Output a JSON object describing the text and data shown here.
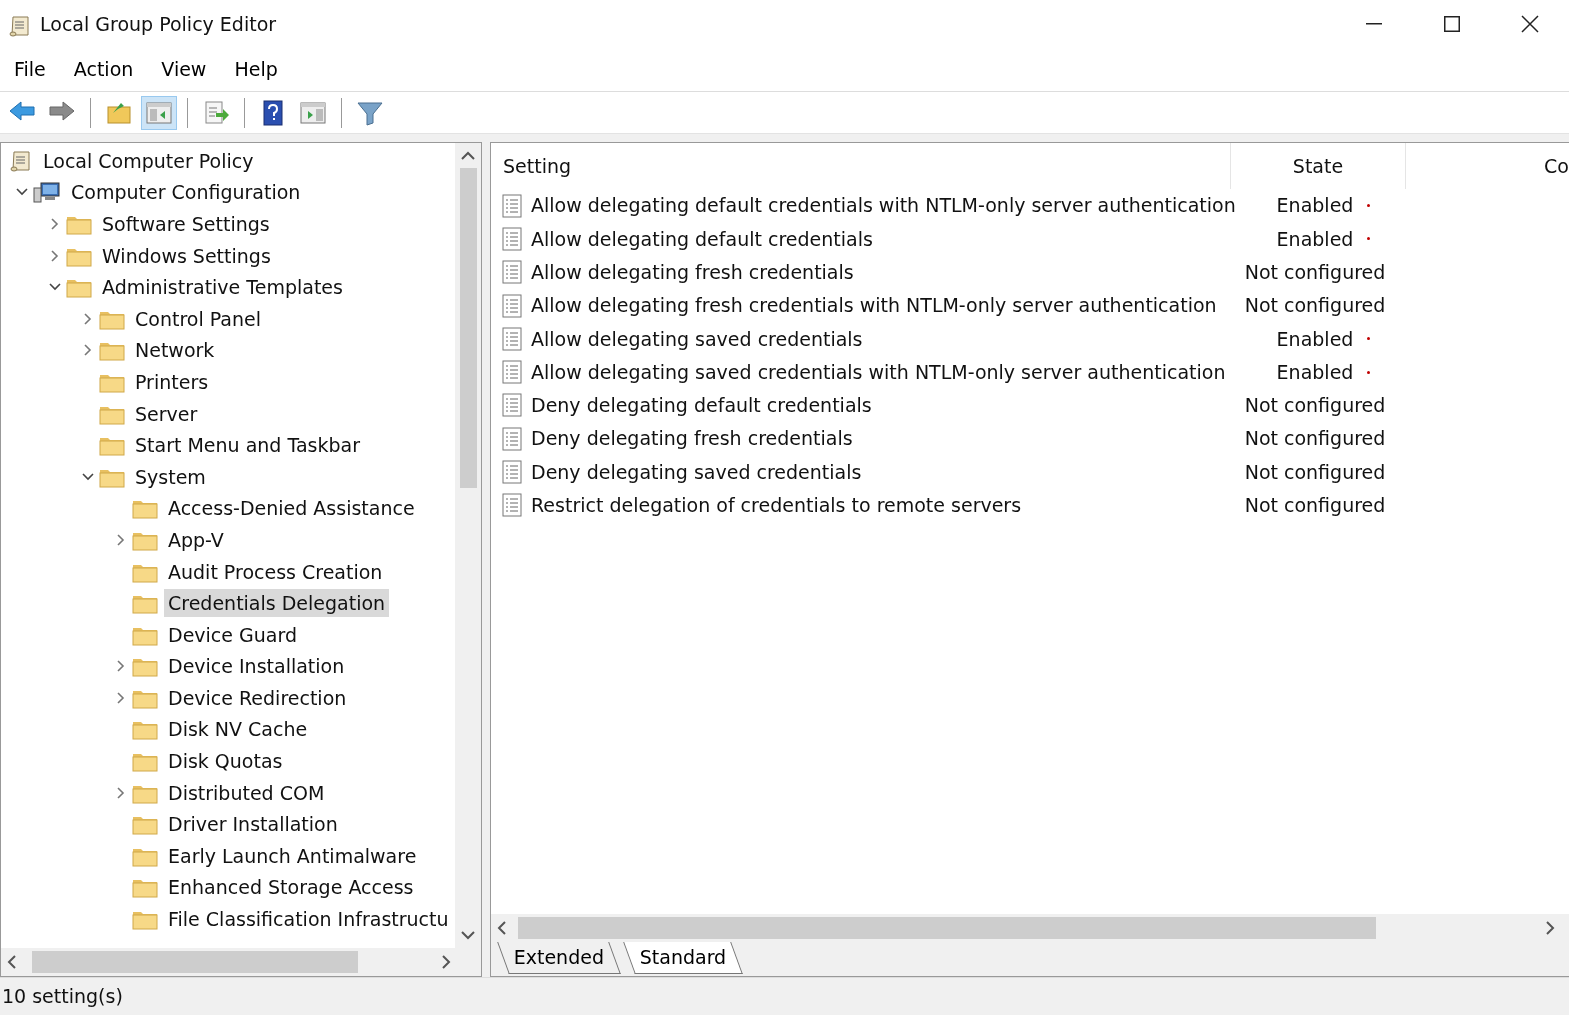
{
  "window": {
    "title": "Local Group Policy Editor"
  },
  "menu": [
    "File",
    "Action",
    "View",
    "Help"
  ],
  "toolbar": [
    {
      "kind": "back"
    },
    {
      "kind": "forward"
    },
    {
      "kind": "sep"
    },
    {
      "kind": "up"
    },
    {
      "kind": "pane",
      "selected": true
    },
    {
      "kind": "sep"
    },
    {
      "kind": "export"
    },
    {
      "kind": "sep"
    },
    {
      "kind": "help"
    },
    {
      "kind": "panel"
    },
    {
      "kind": "sep"
    },
    {
      "kind": "filter"
    }
  ],
  "tree": [
    {
      "label": "Local Computer Policy",
      "kind": "policy",
      "selected": false,
      "children": [
        {
          "label": "Computer Configuration",
          "kind": "computer",
          "expanded": true,
          "selected": false,
          "children": [
            {
              "label": "Software Settings",
              "kind": "folder",
              "expanded": false,
              "selected": false
            },
            {
              "label": "Windows Settings",
              "kind": "folder",
              "expanded": false,
              "selected": false
            },
            {
              "label": "Administrative Templates",
              "kind": "folder",
              "expanded": true,
              "selected": false,
              "children": [
                {
                  "label": "Control Panel",
                  "kind": "folder",
                  "expanded": false,
                  "selected": false
                },
                {
                  "label": "Network",
                  "kind": "folder",
                  "expanded": false,
                  "selected": false
                },
                {
                  "label": "Printers",
                  "kind": "folder",
                  "selected": false
                },
                {
                  "label": "Server",
                  "kind": "folder",
                  "selected": false
                },
                {
                  "label": "Start Menu and Taskbar",
                  "kind": "folder",
                  "selected": false
                },
                {
                  "label": "System",
                  "kind": "folder",
                  "expanded": true,
                  "selected": false,
                  "children": [
                    {
                      "label": "Access-Denied Assistance",
                      "kind": "folder",
                      "selected": false
                    },
                    {
                      "label": "App-V",
                      "kind": "folder",
                      "expanded": false,
                      "selected": false
                    },
                    {
                      "label": "Audit Process Creation",
                      "kind": "folder",
                      "selected": false
                    },
                    {
                      "label": "Credentials Delegation",
                      "kind": "folder",
                      "selected": true
                    },
                    {
                      "label": "Device Guard",
                      "kind": "folder",
                      "selected": false
                    },
                    {
                      "label": "Device Installation",
                      "kind": "folder",
                      "expanded": false,
                      "selected": false
                    },
                    {
                      "label": "Device Redirection",
                      "kind": "folder",
                      "expanded": false,
                      "selected": false
                    },
                    {
                      "label": "Disk NV Cache",
                      "kind": "folder",
                      "selected": false
                    },
                    {
                      "label": "Disk Quotas",
                      "kind": "folder",
                      "selected": false
                    },
                    {
                      "label": "Distributed COM",
                      "kind": "folder",
                      "expanded": false,
                      "selected": false
                    },
                    {
                      "label": "Driver Installation",
                      "kind": "folder",
                      "selected": false
                    },
                    {
                      "label": "Early Launch Antimalware",
                      "kind": "folder",
                      "selected": false
                    },
                    {
                      "label": "Enhanced Storage Access",
                      "kind": "folder",
                      "selected": false
                    },
                    {
                      "label": "File Classification Infrastructu",
                      "kind": "folder",
                      "selected": false
                    }
                  ]
                }
              ]
            }
          ]
        }
      ]
    }
  ],
  "table": {
    "columns": [
      "Setting",
      "State",
      "Co"
    ],
    "rows": [
      {
        "setting": "Allow delegating default credentials with NTLM-only server authentication",
        "state": "Enabled",
        "flagged": true
      },
      {
        "setting": "Allow delegating default credentials",
        "state": "Enabled",
        "flagged": true
      },
      {
        "setting": "Allow delegating fresh credentials",
        "state": "Not configured",
        "flagged": false
      },
      {
        "setting": "Allow delegating fresh credentials with NTLM-only server authentication",
        "state": "Not configured",
        "flagged": false
      },
      {
        "setting": "Allow delegating saved credentials",
        "state": "Enabled",
        "flagged": true
      },
      {
        "setting": "Allow delegating saved credentials with NTLM-only server authentication",
        "state": "Enabled",
        "flagged": true
      },
      {
        "setting": "Deny delegating default credentials",
        "state": "Not configured",
        "flagged": false
      },
      {
        "setting": "Deny delegating fresh credentials",
        "state": "Not configured",
        "flagged": false
      },
      {
        "setting": "Deny delegating saved credentials",
        "state": "Not configured",
        "flagged": false
      },
      {
        "setting": "Restrict delegation of credentials to remote servers",
        "state": "Not configured",
        "flagged": false
      }
    ]
  },
  "view_tabs": [
    {
      "label": "Extended",
      "selected": false
    },
    {
      "label": "Standard",
      "selected": true
    }
  ],
  "status_bar": "10 setting(s)"
}
